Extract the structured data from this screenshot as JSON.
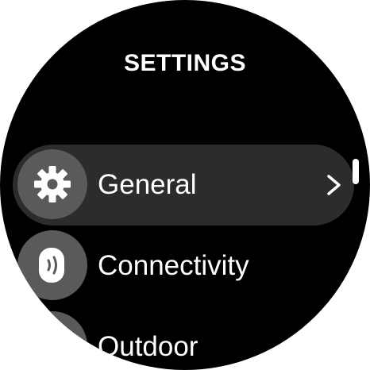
{
  "header": {
    "title": "SETTINGS"
  },
  "menu": {
    "items": [
      {
        "label": "General",
        "icon": "gear-icon",
        "selected": true
      },
      {
        "label": "Connectivity",
        "icon": "connectivity-icon",
        "selected": false
      },
      {
        "label": "Outdoor",
        "icon": "outdoor-icon",
        "selected": false
      }
    ]
  },
  "colors": {
    "background": "#000000",
    "selected_row": "#2c2c2c",
    "icon_circle": "#5a5a5a",
    "text": "#ffffff"
  }
}
